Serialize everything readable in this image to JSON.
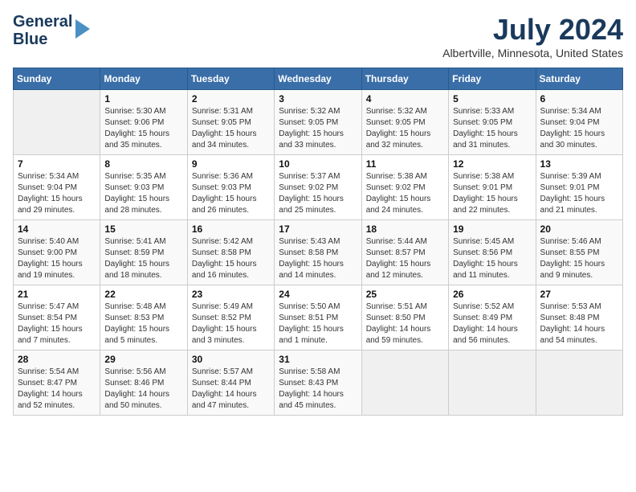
{
  "header": {
    "logo_line1": "General",
    "logo_line2": "Blue",
    "month": "July 2024",
    "location": "Albertville, Minnesota, United States"
  },
  "weekdays": [
    "Sunday",
    "Monday",
    "Tuesday",
    "Wednesday",
    "Thursday",
    "Friday",
    "Saturday"
  ],
  "weeks": [
    [
      {
        "day": "",
        "empty": true
      },
      {
        "day": "1",
        "sunrise": "5:30 AM",
        "sunset": "9:06 PM",
        "daylight": "15 hours and 35 minutes."
      },
      {
        "day": "2",
        "sunrise": "5:31 AM",
        "sunset": "9:05 PM",
        "daylight": "15 hours and 34 minutes."
      },
      {
        "day": "3",
        "sunrise": "5:32 AM",
        "sunset": "9:05 PM",
        "daylight": "15 hours and 33 minutes."
      },
      {
        "day": "4",
        "sunrise": "5:32 AM",
        "sunset": "9:05 PM",
        "daylight": "15 hours and 32 minutes."
      },
      {
        "day": "5",
        "sunrise": "5:33 AM",
        "sunset": "9:05 PM",
        "daylight": "15 hours and 31 minutes."
      },
      {
        "day": "6",
        "sunrise": "5:34 AM",
        "sunset": "9:04 PM",
        "daylight": "15 hours and 30 minutes."
      }
    ],
    [
      {
        "day": "7",
        "sunrise": "5:34 AM",
        "sunset": "9:04 PM",
        "daylight": "15 hours and 29 minutes."
      },
      {
        "day": "8",
        "sunrise": "5:35 AM",
        "sunset": "9:03 PM",
        "daylight": "15 hours and 28 minutes."
      },
      {
        "day": "9",
        "sunrise": "5:36 AM",
        "sunset": "9:03 PM",
        "daylight": "15 hours and 26 minutes."
      },
      {
        "day": "10",
        "sunrise": "5:37 AM",
        "sunset": "9:02 PM",
        "daylight": "15 hours and 25 minutes."
      },
      {
        "day": "11",
        "sunrise": "5:38 AM",
        "sunset": "9:02 PM",
        "daylight": "15 hours and 24 minutes."
      },
      {
        "day": "12",
        "sunrise": "5:38 AM",
        "sunset": "9:01 PM",
        "daylight": "15 hours and 22 minutes."
      },
      {
        "day": "13",
        "sunrise": "5:39 AM",
        "sunset": "9:01 PM",
        "daylight": "15 hours and 21 minutes."
      }
    ],
    [
      {
        "day": "14",
        "sunrise": "5:40 AM",
        "sunset": "9:00 PM",
        "daylight": "15 hours and 19 minutes."
      },
      {
        "day": "15",
        "sunrise": "5:41 AM",
        "sunset": "8:59 PM",
        "daylight": "15 hours and 18 minutes."
      },
      {
        "day": "16",
        "sunrise": "5:42 AM",
        "sunset": "8:58 PM",
        "daylight": "15 hours and 16 minutes."
      },
      {
        "day": "17",
        "sunrise": "5:43 AM",
        "sunset": "8:58 PM",
        "daylight": "15 hours and 14 minutes."
      },
      {
        "day": "18",
        "sunrise": "5:44 AM",
        "sunset": "8:57 PM",
        "daylight": "15 hours and 12 minutes."
      },
      {
        "day": "19",
        "sunrise": "5:45 AM",
        "sunset": "8:56 PM",
        "daylight": "15 hours and 11 minutes."
      },
      {
        "day": "20",
        "sunrise": "5:46 AM",
        "sunset": "8:55 PM",
        "daylight": "15 hours and 9 minutes."
      }
    ],
    [
      {
        "day": "21",
        "sunrise": "5:47 AM",
        "sunset": "8:54 PM",
        "daylight": "15 hours and 7 minutes."
      },
      {
        "day": "22",
        "sunrise": "5:48 AM",
        "sunset": "8:53 PM",
        "daylight": "15 hours and 5 minutes."
      },
      {
        "day": "23",
        "sunrise": "5:49 AM",
        "sunset": "8:52 PM",
        "daylight": "15 hours and 3 minutes."
      },
      {
        "day": "24",
        "sunrise": "5:50 AM",
        "sunset": "8:51 PM",
        "daylight": "15 hours and 1 minute."
      },
      {
        "day": "25",
        "sunrise": "5:51 AM",
        "sunset": "8:50 PM",
        "daylight": "14 hours and 59 minutes."
      },
      {
        "day": "26",
        "sunrise": "5:52 AM",
        "sunset": "8:49 PM",
        "daylight": "14 hours and 56 minutes."
      },
      {
        "day": "27",
        "sunrise": "5:53 AM",
        "sunset": "8:48 PM",
        "daylight": "14 hours and 54 minutes."
      }
    ],
    [
      {
        "day": "28",
        "sunrise": "5:54 AM",
        "sunset": "8:47 PM",
        "daylight": "14 hours and 52 minutes."
      },
      {
        "day": "29",
        "sunrise": "5:56 AM",
        "sunset": "8:46 PM",
        "daylight": "14 hours and 50 minutes."
      },
      {
        "day": "30",
        "sunrise": "5:57 AM",
        "sunset": "8:44 PM",
        "daylight": "14 hours and 47 minutes."
      },
      {
        "day": "31",
        "sunrise": "5:58 AM",
        "sunset": "8:43 PM",
        "daylight": "14 hours and 45 minutes."
      },
      {
        "day": "",
        "empty": true
      },
      {
        "day": "",
        "empty": true
      },
      {
        "day": "",
        "empty": true
      }
    ]
  ]
}
